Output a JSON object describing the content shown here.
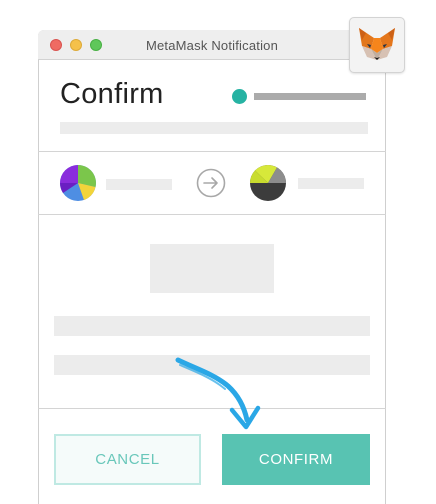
{
  "window": {
    "title": "MetaMask Notification"
  },
  "header": {
    "title": "Confirm",
    "account_color": "#26b3a3"
  },
  "route": {
    "arrow_icon": "arrow-right-icon"
  },
  "footer": {
    "cancel_label": "CANCEL",
    "confirm_label": "CONFIRM"
  },
  "colors": {
    "accent": "#58c3b2",
    "cancel_border": "#bfe9e3",
    "cancel_text": "#69c7ba",
    "hint_arrow": "#2aa7e6"
  },
  "icons": {
    "app_logo": "metamask-fox-icon",
    "from_avatar": "identicon-from-icon",
    "to_avatar": "identicon-to-icon",
    "hint": "hand-drawn-arrow-icon"
  }
}
